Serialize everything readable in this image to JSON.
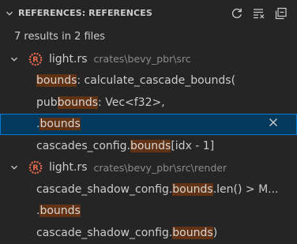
{
  "header": {
    "title": "REFERENCES: REFERENCES",
    "actions": [
      {
        "icon": "refresh-icon"
      },
      {
        "icon": "clear-icon"
      },
      {
        "icon": "collapse-all-icon"
      }
    ]
  },
  "summary": "7 results in 2 files",
  "groups": [
    {
      "file": "light.rs",
      "path": "crates\\bevy_pbr\\src",
      "matches": [
        {
          "before": "",
          "match": "bounds",
          "after": ": calculate_cascade_bounds("
        },
        {
          "before": "pub ",
          "match": "bounds",
          "after": ": Vec<f32>,"
        },
        {
          "before": ".",
          "match": "bounds",
          "after": "",
          "selected": true
        },
        {
          "before": "cascades_config.",
          "match": "bounds",
          "after": "[idx - 1]"
        }
      ]
    },
    {
      "file": "light.rs",
      "path": "crates\\bevy_pbr\\src\\render",
      "matches": [
        {
          "before": "cascade_shadow_config.",
          "match": "bounds",
          "after": ".len() > M..."
        },
        {
          "before": ".",
          "match": "bounds",
          "after": ""
        },
        {
          "before": "cascade_shadow_config.",
          "match": "bounds",
          "after": ")"
        }
      ]
    }
  ],
  "colors": {
    "background": "#252526",
    "match_highlight": "#613214",
    "selection": "#04395e",
    "focus_border": "#0078d4",
    "rust_icon": "#e2694b"
  }
}
